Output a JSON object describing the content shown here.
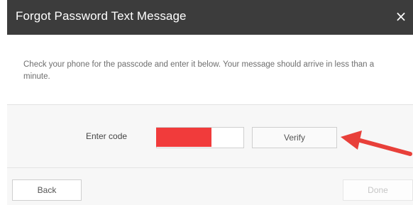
{
  "dialog": {
    "title": "Forgot Password Text Message",
    "close_symbol": "×",
    "message": "Check your phone for the passcode and enter it below. Your message should arrive in less than a minute."
  },
  "code_entry": {
    "label": "Enter code",
    "input_value": "",
    "verify_label": "Verify",
    "redaction_color": "#f13b3b"
  },
  "annotation": {
    "arrow_color": "#e8403a",
    "points_to": "Verify"
  },
  "footer": {
    "back_label": "Back",
    "done_label": "Done",
    "done_disabled": true
  },
  "colors": {
    "titlebar_bg": "#3c3c3c",
    "panel_bg": "#f7f7f7",
    "body_text": "#6e6e6e"
  }
}
